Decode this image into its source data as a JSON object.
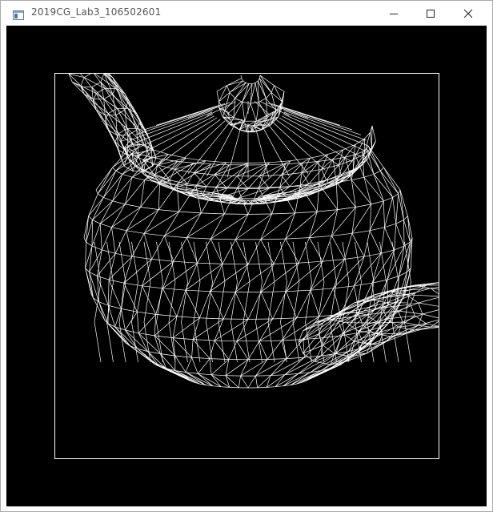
{
  "window": {
    "title": "2019CG_Lab3_106502601",
    "icon": "application-window-icon",
    "controls": [
      "minimize-icon",
      "maximize-icon",
      "close-icon"
    ]
  },
  "canvas": {
    "background": "#000000",
    "line_color": "#ffffff",
    "render_mode": "wireframe",
    "model": "teapot"
  }
}
